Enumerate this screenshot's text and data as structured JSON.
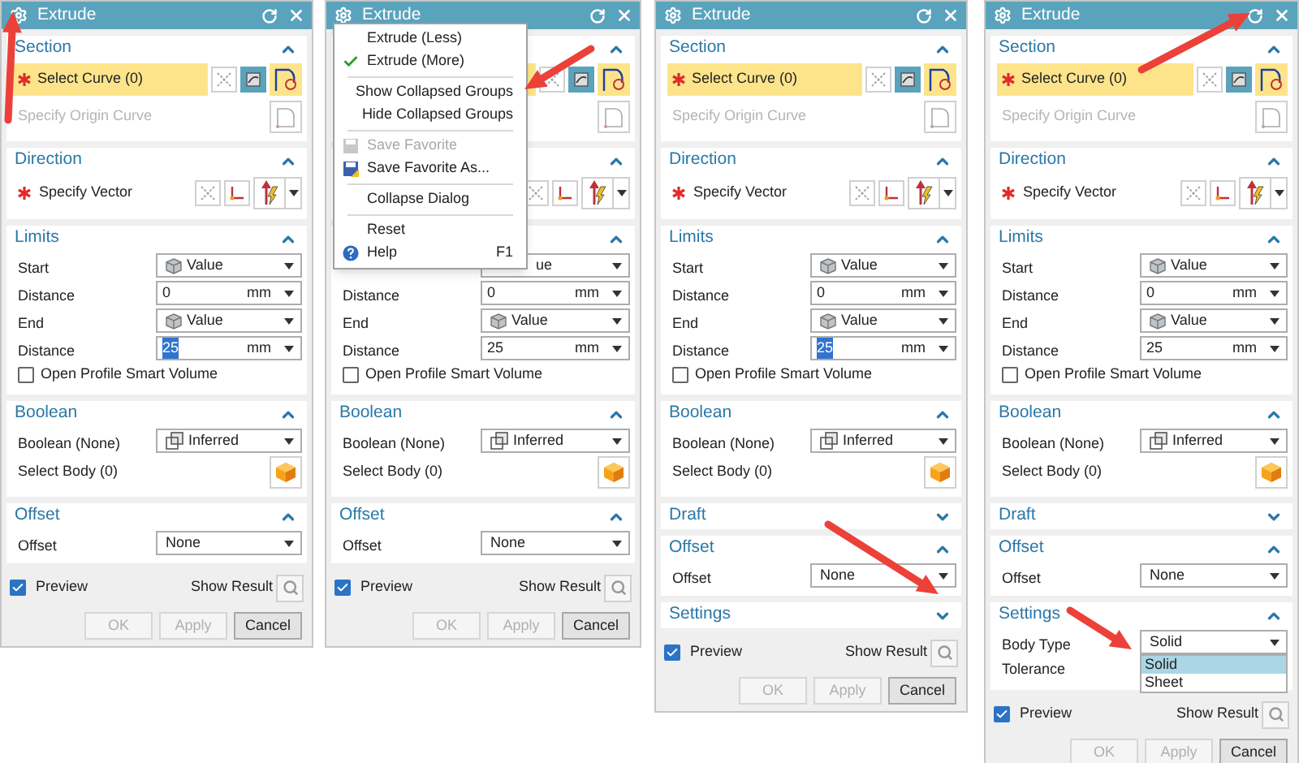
{
  "dialogs": [
    {
      "title": "Extrude",
      "groups": [
        {
          "title": "Section",
          "expanded": true,
          "rows": [
            {
              "kind": "select",
              "label": "Select Curve (0)",
              "required": true,
              "highlighted": true
            },
            {
              "kind": "origin",
              "label": "Specify Origin Curve",
              "disabled": true
            }
          ]
        },
        {
          "title": "Direction",
          "expanded": true,
          "rows": [
            {
              "kind": "vector",
              "label": "Specify Vector",
              "required": true
            }
          ]
        },
        {
          "title": "Limits",
          "expanded": true,
          "rows": [
            {
              "kind": "limit",
              "label": "Start",
              "value": "Value"
            },
            {
              "kind": "distance",
              "label": "Distance",
              "value": "0",
              "unit": "mm",
              "selected": false
            },
            {
              "kind": "limit",
              "label": "End",
              "value": "Value"
            },
            {
              "kind": "distance",
              "label": "Distance",
              "value": "25",
              "unit": "mm",
              "selected": true
            },
            {
              "kind": "checkbox",
              "label": "Open Profile Smart Volume",
              "checked": false
            }
          ]
        },
        {
          "title": "Boolean",
          "expanded": true,
          "rows": [
            {
              "kind": "boolean",
              "label": "Boolean (None)",
              "value": "Inferred"
            },
            {
              "kind": "body",
              "label": "Select Body (0)"
            }
          ]
        },
        {
          "title": "Offset",
          "expanded": true,
          "rows": [
            {
              "kind": "dropdown",
              "label": "Offset",
              "value": "None"
            }
          ]
        }
      ],
      "preview": {
        "label": "Preview",
        "checked": true
      },
      "show_result": "Show Result",
      "buttons": [
        {
          "label": "OK",
          "disabled": true
        },
        {
          "label": "Apply",
          "disabled": true
        },
        {
          "label": "Cancel",
          "disabled": false
        }
      ]
    },
    {
      "title": "Extrude",
      "groups": [
        {
          "expanded": true,
          "rows": [
            {
              "kind": "select",
              "highlighted": true
            },
            {
              "kind": "origin"
            }
          ]
        },
        {
          "expanded": true,
          "rows": [
            {
              "kind": "vector"
            }
          ]
        },
        {
          "expanded": true,
          "rows": [
            {
              "kind": "dropdown",
              "value": "ue"
            },
            {
              "kind": "distance",
              "label": "Distance",
              "value": "0",
              "unit": "mm",
              "selected": false
            },
            {
              "kind": "limit",
              "label": "End",
              "value": "Value"
            },
            {
              "kind": "distance",
              "label": "Distance",
              "value": "25",
              "unit": "mm",
              "selected": false
            },
            {
              "kind": "checkbox",
              "label": "Open Profile Smart Volume",
              "checked": false
            }
          ]
        },
        {
          "title": "Boolean",
          "expanded": true,
          "rows": [
            {
              "kind": "boolean",
              "label": "Boolean (None)",
              "value": "Inferred"
            },
            {
              "kind": "body",
              "label": "Select Body (0)"
            }
          ]
        },
        {
          "title": "Offset",
          "expanded": true,
          "rows": [
            {
              "kind": "dropdown",
              "label": "Offset",
              "value": "None"
            }
          ]
        }
      ],
      "preview": {
        "label": "Preview",
        "checked": true
      },
      "show_result": "Show Result",
      "buttons": [
        {
          "label": "OK",
          "disabled": true
        },
        {
          "label": "Apply",
          "disabled": true
        },
        {
          "label": "Cancel",
          "disabled": false
        }
      ],
      "menu": [
        {
          "kind": "item",
          "label": "Extrude (Less)",
          "checked": false,
          "disabled": false
        },
        {
          "kind": "item",
          "label": "Extrude (More)",
          "checked": true,
          "disabled": false
        },
        {
          "kind": "divider"
        },
        {
          "kind": "item",
          "label": "Show Collapsed Groups",
          "checked": false,
          "disabled": false
        },
        {
          "kind": "item",
          "label": "Hide Collapsed Groups",
          "checked": false,
          "disabled": false
        },
        {
          "kind": "divider"
        },
        {
          "kind": "save",
          "label": "Save Favorite",
          "checked": false,
          "disabled": true
        },
        {
          "kind": "saveas",
          "label": "Save Favorite As...",
          "checked": false,
          "disabled": false
        },
        {
          "kind": "divider"
        },
        {
          "kind": "item",
          "label": "Collapse Dialog",
          "checked": false,
          "disabled": false
        },
        {
          "kind": "divider"
        },
        {
          "kind": "item",
          "label": "Reset",
          "checked": false,
          "disabled": false
        },
        {
          "kind": "help",
          "label": "Help",
          "checked": false,
          "disabled": false,
          "shortcut": "F1"
        }
      ]
    },
    {
      "title": "Extrude",
      "groups": [
        {
          "title": "Section",
          "expanded": true,
          "rows": [
            {
              "kind": "select",
              "label": "Select Curve (0)",
              "required": true,
              "highlighted": true
            },
            {
              "kind": "origin",
              "label": "Specify Origin Curve",
              "disabled": true
            }
          ]
        },
        {
          "title": "Direction",
          "expanded": true,
          "rows": [
            {
              "kind": "vector",
              "label": "Specify Vector",
              "required": true
            }
          ]
        },
        {
          "title": "Limits",
          "expanded": true,
          "rows": [
            {
              "kind": "limit",
              "label": "Start",
              "value": "Value"
            },
            {
              "kind": "distance",
              "label": "Distance",
              "value": "0",
              "unit": "mm",
              "selected": false
            },
            {
              "kind": "limit",
              "label": "End",
              "value": "Value"
            },
            {
              "kind": "distance",
              "label": "Distance",
              "value": "25",
              "unit": "mm",
              "selected": true
            },
            {
              "kind": "checkbox",
              "label": "Open Profile Smart Volume",
              "checked": false
            }
          ]
        },
        {
          "title": "Boolean",
          "expanded": true,
          "rows": [
            {
              "kind": "boolean",
              "label": "Boolean (None)",
              "value": "Inferred"
            },
            {
              "kind": "body",
              "label": "Select Body (0)"
            }
          ]
        },
        {
          "title": "Draft",
          "expanded": false
        },
        {
          "title": "Offset",
          "expanded": true,
          "rows": [
            {
              "kind": "dropdown",
              "label": "Offset",
              "value": "None"
            }
          ]
        },
        {
          "title": "Settings",
          "expanded": false
        }
      ],
      "preview": {
        "label": "Preview",
        "checked": true
      },
      "show_result": "Show Result",
      "buttons": [
        {
          "label": "OK",
          "disabled": true
        },
        {
          "label": "Apply",
          "disabled": true
        },
        {
          "label": "Cancel",
          "disabled": false
        }
      ]
    },
    {
      "title": "Extrude",
      "groups": [
        {
          "title": "Section",
          "expanded": true,
          "rows": [
            {
              "kind": "select",
              "label": "Select Curve (0)",
              "required": true,
              "highlighted": true
            },
            {
              "kind": "origin",
              "label": "Specify Origin Curve",
              "disabled": true
            }
          ]
        },
        {
          "title": "Direction",
          "expanded": true,
          "rows": [
            {
              "kind": "vector",
              "label": "Specify Vector",
              "required": true
            }
          ]
        },
        {
          "title": "Limits",
          "expanded": true,
          "rows": [
            {
              "kind": "limit",
              "label": "Start",
              "value": "Value"
            },
            {
              "kind": "distance",
              "label": "Distance",
              "value": "0",
              "unit": "mm",
              "selected": false
            },
            {
              "kind": "limit",
              "label": "End",
              "value": "Value"
            },
            {
              "kind": "distance",
              "label": "Distance",
              "value": "25",
              "unit": "mm",
              "selected": false
            },
            {
              "kind": "checkbox",
              "label": "Open Profile Smart Volume",
              "checked": false
            }
          ]
        },
        {
          "title": "Boolean",
          "expanded": true,
          "rows": [
            {
              "kind": "boolean",
              "label": "Boolean (None)",
              "value": "Inferred"
            },
            {
              "kind": "body",
              "label": "Select Body (0)"
            }
          ]
        },
        {
          "title": "Draft",
          "expanded": false
        },
        {
          "title": "Offset",
          "expanded": true,
          "rows": [
            {
              "kind": "dropdown",
              "label": "Offset",
              "value": "None"
            }
          ]
        },
        {
          "title": "Settings",
          "expanded": true,
          "rows": [
            {
              "kind": "dropdown",
              "label": "Body Type",
              "value": "Solid",
              "options": [
                {
                  "label": "Solid",
                  "selected": true
                },
                {
                  "label": "Sheet",
                  "selected": false
                }
              ]
            },
            {
              "kind": "label",
              "label": "Tolerance"
            }
          ]
        }
      ],
      "preview": {
        "label": "Preview",
        "checked": true
      },
      "show_result": "Show Result",
      "buttons": [
        {
          "label": "OK",
          "disabled": true
        },
        {
          "label": "Apply",
          "disabled": true
        },
        {
          "label": "Cancel",
          "disabled": false
        }
      ]
    }
  ]
}
